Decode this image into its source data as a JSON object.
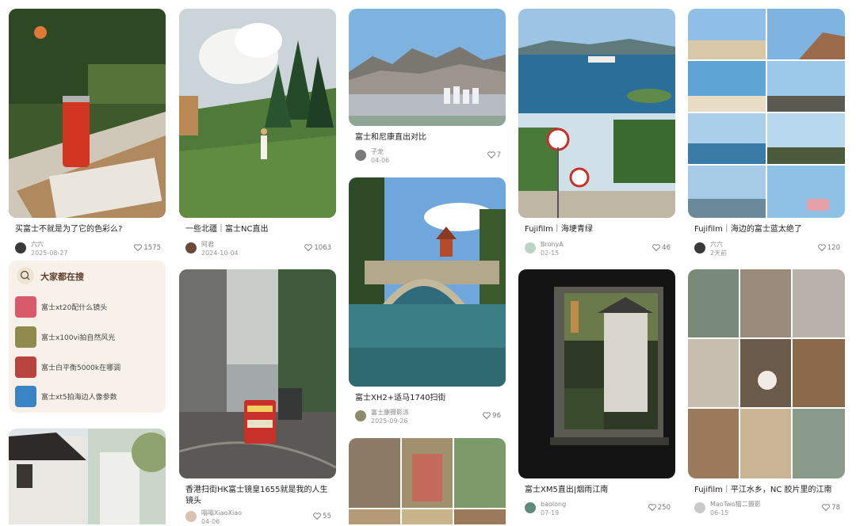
{
  "columns": [
    {
      "cards": [
        {
          "title": "买富士不就是为了它的色彩么?",
          "author": "六六",
          "date": "2025-08-27",
          "likes": "1575",
          "image_icon": "photo-coke-can-newspaper",
          "avatar_color": "#3a3a3a"
        },
        {
          "title": "",
          "author": "",
          "date": "",
          "likes": "",
          "image_icon": "photo-white-house-alley",
          "avatar_color": ""
        }
      ]
    },
    {
      "cards": [
        {
          "title": "一些北疆｜富士NC直出",
          "author": "阿君",
          "date": "2024-10-04",
          "likes": "1063",
          "image_icon": "photo-meadow-clouds-girl",
          "avatar_color": "#6b4a3c"
        },
        {
          "title": "香港扫街HK富士镜皇1655就是我的人生镜头",
          "author": "嗡嗡XiaoXiao",
          "date": "04-06",
          "likes": "55",
          "image_icon": "photo-hongkong-tram",
          "avatar_color": "#d9c2b0"
        }
      ]
    },
    {
      "cards": [
        {
          "title": "富士和尼康直出对比",
          "author": "子龙",
          "date": "04-06",
          "likes": "7",
          "image_icon": "photo-mountains-city",
          "avatar_color": "#7a7a7a"
        },
        {
          "title": "富士XH2+适马1740扫街",
          "author": "富士康摄影派",
          "date": "2025-09-26",
          "likes": "96",
          "image_icon": "photo-stone-bridge-pagoda",
          "avatar_color": "#8c8c6a"
        },
        {
          "title": "",
          "author": "",
          "date": "",
          "likes": "",
          "image_icon": "photo-grid-street-collage",
          "avatar_color": ""
        }
      ]
    },
    {
      "cards": [
        {
          "title": "Fujifilm｜海埂青绿",
          "author": "BronyA",
          "date": "02-15",
          "likes": "46",
          "image_icon": "photo-lake-gulls-signs",
          "avatar_color": "#bcd3c5"
        },
        {
          "title": "富士XM5直出|烟雨江南",
          "author": "baolong",
          "date": "07-19",
          "likes": "250",
          "image_icon": "photo-window-frame-view",
          "avatar_color": "#5f8c7a"
        }
      ]
    },
    {
      "cards": [
        {
          "title": "Fujifilm｜海边的富士蓝太绝了",
          "author": "六六",
          "date": "2天前",
          "likes": "120",
          "image_icon": "photo-grid-seaside",
          "avatar_color": "#3a3a3a"
        },
        {
          "title": "Fujifilm｜平江水乡，NC 胶片里的江南",
          "author": "MaoTwo猫二摄影",
          "date": "06-15",
          "likes": "78",
          "image_icon": "photo-grid-water-town",
          "avatar_color": "#c9c9c9"
        }
      ]
    }
  ],
  "trending": {
    "title": "大家都在搜",
    "icon": "search-icon",
    "items": [
      {
        "label": "富士xt20配什么镜头",
        "thumb_color": "#d95a6a"
      },
      {
        "label": "富士x100vi拍自然风光",
        "thumb_color": "#8f8a4e"
      },
      {
        "label": "富士白平衡5000k在哪调",
        "thumb_color": "#b8433f"
      },
      {
        "label": "富士xt5拍海边人像参数",
        "thumb_color": "#3a84c4"
      }
    ]
  },
  "colors": {
    "accent": "#5a3d2b",
    "panel_bg": "#f7f1e9",
    "text_muted": "#888888"
  }
}
